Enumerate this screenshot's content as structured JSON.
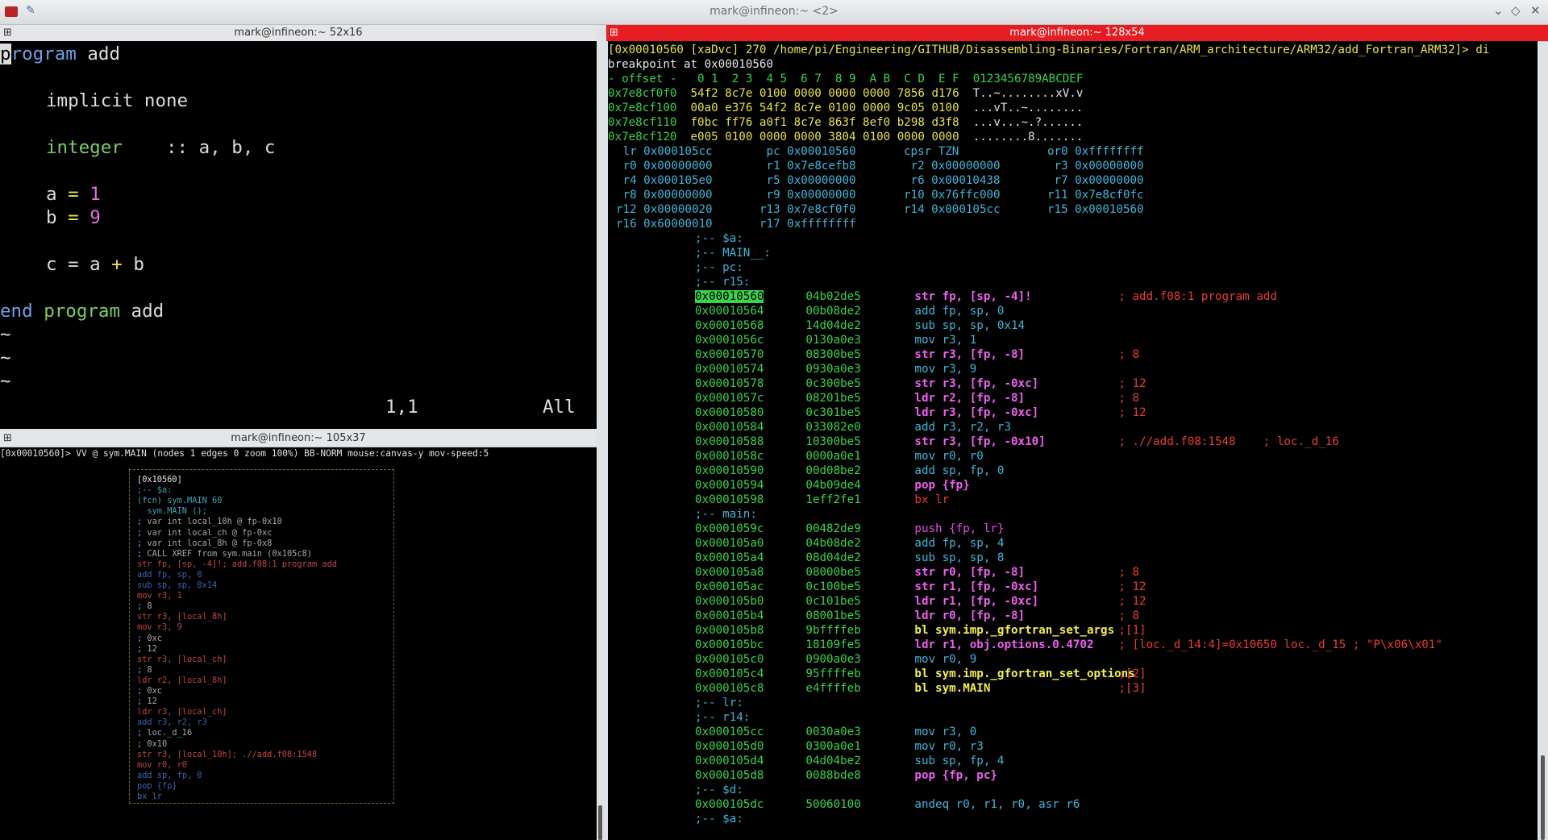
{
  "window": {
    "title": "mark@infineon:~ <2>"
  },
  "panes": {
    "vim": {
      "header": "mark@infineon:~ 52x16"
    },
    "graph": {
      "header": "mark@infineon:~ 105x37"
    },
    "r2": {
      "header": "mark@infineon:~ 128x54"
    }
  },
  "vim": {
    "ruler": "1,1",
    "scroll": "All",
    "lines": {
      "l1_kw": "program",
      "l1_rest": " add",
      "l3": "implicit none",
      "l5_kw": "integer",
      "l5_rest": "    :: a, b, c",
      "l7_a": "a",
      "l7_eq": "=",
      "l7_v": "1",
      "l8_a": "b",
      "l8_eq": "=",
      "l8_v": "9",
      "l10_c": "c = a",
      "l10_op": "+",
      "l10_b": " b",
      "l12_end": "end",
      "l12_prog": "program",
      "l12_rest": " add",
      "tilde": "~"
    }
  },
  "graph": {
    "status": "[0x00010560]> VV @ sym.MAIN (nodes 1 edges 0 zoom 100%) BB-NORM mouse:canvas-y mov-speed:5",
    "lines": [
      "[0x10560]",
      ";-- $a:",
      "(fcn) sym.MAIN 60",
      "  sym.MAIN ();",
      "; var int local_10h @ fp-0x10",
      "; var int local_ch @ fp-0xc",
      "; var int local_8h @ fp-0x8",
      "; CALL XREF from sym.main (0x105c8)",
      "str fp, [sp, -4]!; add.f08:1 program add",
      "add fp, sp, 0",
      "sub sp, sp, 0x14",
      "mov r3, 1",
      "; 8",
      "str r3, [local_8h]",
      "mov r3, 9",
      "; 0xc",
      "; 12",
      "str r3, [local_ch]",
      "; 8",
      "ldr r2, [local_8h]",
      "; 0xc",
      "; 12",
      "ldr r3, [local_ch]",
      "add r3, r2, r3",
      "; loc._d_16",
      "; 0x10",
      "str r3, [local_10h]; .//add.f08:1548",
      "mov r0, r0",
      "add sp, fp, 0",
      "pop {fp}",
      "bx lr"
    ]
  },
  "r2": {
    "prompt": "[0x00010560 [xaDvc] 270 /home/pi/Engineering/GITHUB/Disassembling-Binaries/Fortran/ARM_architecture/ARM32/add_Fortran_ARM32]> di",
    "breakpoint": "breakpoint at 0x00010560",
    "hex_header": "- offset -   0 1  2 3  4 5  6 7  8 9  A B  C D  E F  0123456789ABCDEF",
    "hex_rows": [
      {
        "addr": "0x7e8cf0f0",
        "bytes": "54f2 8c7e 0100 0000 0000 0000 7856 d176",
        "ascii": "T..~........xV.v"
      },
      {
        "addr": "0x7e8cf100",
        "bytes": "00a0 e376 54f2 8c7e 0100 0000 9c05 0100",
        "ascii": "...vT..~........"
      },
      {
        "addr": "0x7e8cf110",
        "bytes": "f0bc ff76 a0f1 8c7e 863f 8ef0 b298 d3f8",
        "ascii": "...v...~.?......"
      },
      {
        "addr": "0x7e8cf120",
        "bytes": "e005 0100 0000 0000 3804 0100 0000 0000",
        "ascii": "........8......."
      }
    ],
    "regs": [
      [
        "lr",
        "0x000105cc",
        "pc",
        "0x00010560",
        "cpsr",
        "TZN",
        "or0",
        "0xffffffff"
      ],
      [
        "r0",
        "0x00000000",
        "r1",
        "0x7e8cefb8",
        "r2",
        "0x00000000",
        "r3",
        "0x00000000"
      ],
      [
        "r4",
        "0x000105e0",
        "r5",
        "0x00000000",
        "r6",
        "0x00010438",
        "r7",
        "0x00000000"
      ],
      [
        "r8",
        "0x00000000",
        "r9",
        "0x00000000",
        "r10",
        "0x76ffc000",
        "r11",
        "0x7e8cf0fc"
      ],
      [
        "r12",
        "0x00000020",
        "r13",
        "0x7e8cf0f0",
        "r14",
        "0x000105cc",
        "r15",
        "0x00010560"
      ],
      [
        "r16",
        "0x60000010",
        "r17",
        "0xffffffff"
      ]
    ],
    "flags": [
      ";-- $a:",
      ";-- MAIN__:",
      ";-- pc:",
      ";-- r15:"
    ],
    "disasm": [
      {
        "addr": "0x00010560",
        "bytes": "04b02de5",
        "ins": "str fp, [sp, -4]!",
        "cmt": "; add.f08:1 program add"
      },
      {
        "addr": "0x00010564",
        "bytes": "00b08de2",
        "ins": "add fp, sp, 0",
        "cmt": ""
      },
      {
        "addr": "0x00010568",
        "bytes": "14d04de2",
        "ins": "sub sp, sp, 0x14",
        "cmt": ""
      },
      {
        "addr": "0x0001056c",
        "bytes": "0130a0e3",
        "ins": "mov r3, 1",
        "cmt": ""
      },
      {
        "addr": "0x00010570",
        "bytes": "08300be5",
        "ins": "str r3, [fp, -8]",
        "cmt": "; 8"
      },
      {
        "addr": "0x00010574",
        "bytes": "0930a0e3",
        "ins": "mov r3, 9",
        "cmt": ""
      },
      {
        "addr": "0x00010578",
        "bytes": "0c300be5",
        "ins": "str r3, [fp, -0xc]",
        "cmt": "; 12"
      },
      {
        "addr": "0x0001057c",
        "bytes": "08201be5",
        "ins": "ldr r2, [fp, -8]",
        "cmt": "; 8"
      },
      {
        "addr": "0x00010580",
        "bytes": "0c301be5",
        "ins": "ldr r3, [fp, -0xc]",
        "cmt": "; 12"
      },
      {
        "addr": "0x00010584",
        "bytes": "033082e0",
        "ins": "add r3, r2, r3",
        "cmt": ""
      },
      {
        "addr": "0x00010588",
        "bytes": "10300be5",
        "ins": "str r3, [fp, -0x10]",
        "cmt": "; .//add.f08:1548    ; loc._d_16"
      },
      {
        "addr": "0x0001058c",
        "bytes": "0000a0e1",
        "ins": "mov r0, r0",
        "cmt": ""
      },
      {
        "addr": "0x00010590",
        "bytes": "00d08be2",
        "ins": "add sp, fp, 0",
        "cmt": ""
      },
      {
        "addr": "0x00010594",
        "bytes": "04b09de4",
        "ins": "pop {fp}",
        "cmt": ""
      },
      {
        "addr": "0x00010598",
        "bytes": "1eff2fe1",
        "ins": "bx lr",
        "cmt": ""
      }
    ],
    "main_flag": ";-- main:",
    "disasm2": [
      {
        "addr": "0x0001059c",
        "bytes": "00482de9",
        "ins": "push {fp, lr}",
        "cmt": ""
      },
      {
        "addr": "0x000105a0",
        "bytes": "04b08de2",
        "ins": "add fp, sp, 4",
        "cmt": ""
      },
      {
        "addr": "0x000105a4",
        "bytes": "08d04de2",
        "ins": "sub sp, sp, 8",
        "cmt": ""
      },
      {
        "addr": "0x000105a8",
        "bytes": "08000be5",
        "ins": "str r0, [fp, -8]",
        "cmt": "; 8"
      },
      {
        "addr": "0x000105ac",
        "bytes": "0c100be5",
        "ins": "str r1, [fp, -0xc]",
        "cmt": "; 12"
      },
      {
        "addr": "0x000105b0",
        "bytes": "0c101be5",
        "ins": "ldr r1, [fp, -0xc]",
        "cmt": "; 12"
      },
      {
        "addr": "0x000105b4",
        "bytes": "08001be5",
        "ins": "ldr r0, [fp, -8]",
        "cmt": "; 8"
      },
      {
        "addr": "0x000105b8",
        "bytes": "9bffffeb",
        "ins": "bl sym.imp._gfortran_set_args",
        "cmt": ";[1]"
      },
      {
        "addr": "0x000105bc",
        "bytes": "18109fe5",
        "ins": "ldr r1, obj.options.0.4702",
        "cmt": "; [loc._d_14:4]=0x10650 loc._d_15 ; \"P\\x06\\x01\""
      },
      {
        "addr": "0x000105c0",
        "bytes": "0900a0e3",
        "ins": "mov r0, 9",
        "cmt": ""
      },
      {
        "addr": "0x000105c4",
        "bytes": "95ffffeb",
        "ins": "bl sym.imp._gfortran_set_options",
        "cmt": ";[2]"
      },
      {
        "addr": "0x000105c8",
        "bytes": "e4ffffeb",
        "ins": "bl sym.MAIN",
        "cmt": ";[3]"
      }
    ],
    "flags2": [
      ";-- lr:",
      ";-- r14:"
    ],
    "disasm3": [
      {
        "addr": "0x000105cc",
        "bytes": "0030a0e3",
        "ins": "mov r3, 0",
        "cmt": ""
      },
      {
        "addr": "0x000105d0",
        "bytes": "0300a0e1",
        "ins": "mov r0, r3",
        "cmt": ""
      },
      {
        "addr": "0x000105d4",
        "bytes": "04d04be2",
        "ins": "sub sp, fp, 4",
        "cmt": ""
      },
      {
        "addr": "0x000105d8",
        "bytes": "0088bde8",
        "ins": "pop {fp, pc}",
        "cmt": ""
      }
    ],
    "flag_d": ";-- $d:",
    "disasm4": [
      {
        "addr": "0x000105dc",
        "bytes": "50060100",
        "ins": "andeq r0, r1, r0, asr r6",
        "cmt": ""
      }
    ],
    "flag_last": ";-- $a:"
  }
}
